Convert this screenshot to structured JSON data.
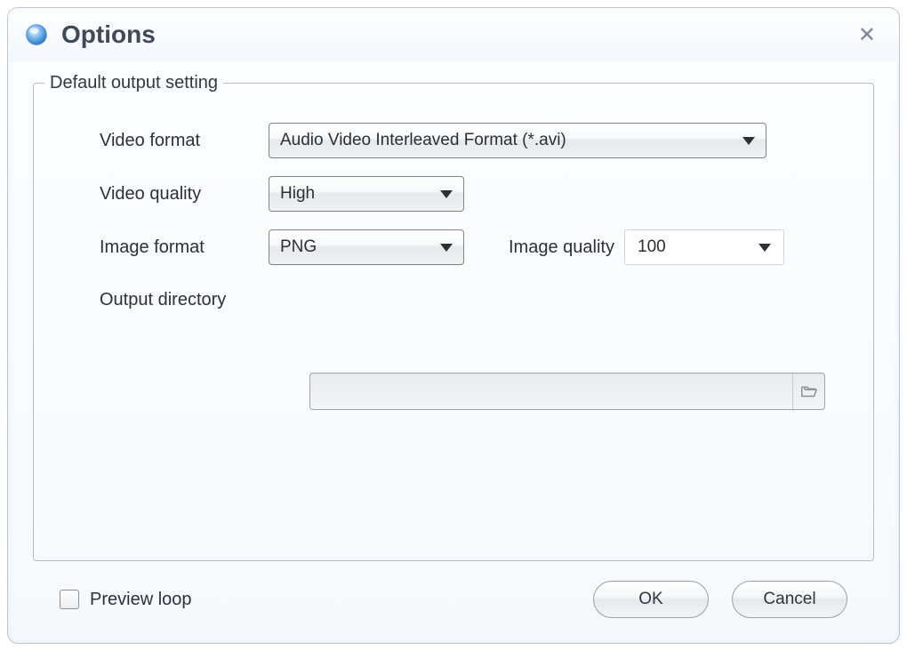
{
  "window": {
    "title": "Options"
  },
  "fieldset": {
    "legend": "Default output setting",
    "video_format": {
      "label": "Video format",
      "value": "Audio Video Interleaved Format (*.avi)"
    },
    "video_quality": {
      "label": "Video quality",
      "value": "High"
    },
    "image_format": {
      "label": "Image format",
      "value": "PNG"
    },
    "image_quality": {
      "label": "Image quality",
      "value": "100"
    },
    "output_directory": {
      "label": "Output directory",
      "value": ""
    }
  },
  "footer": {
    "preview_loop": {
      "label": "Preview loop",
      "checked": false
    },
    "ok": "OK",
    "cancel": "Cancel"
  }
}
